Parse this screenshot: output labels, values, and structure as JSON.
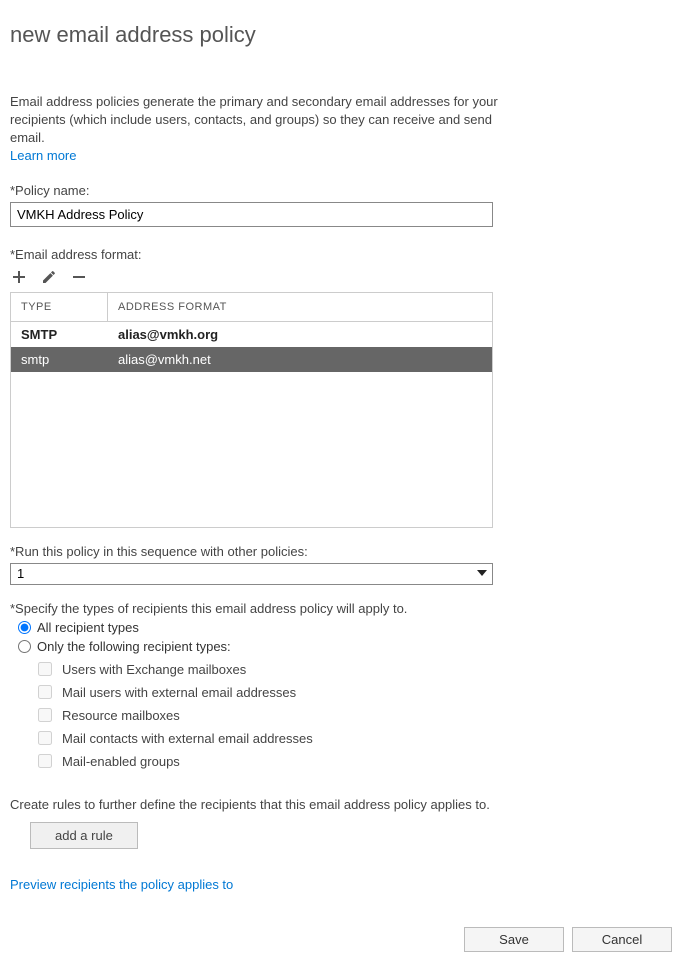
{
  "page": {
    "title": "new email address policy",
    "description": "Email address policies generate the primary and secondary email addresses for your recipients (which include users, contacts, and groups) so they can receive and send email.",
    "learn_more": "Learn more"
  },
  "policy_name": {
    "label": "*Policy name:",
    "value": "VMKH Address Policy"
  },
  "email_format": {
    "label": "*Email address format:",
    "headers": {
      "type": "TYPE",
      "format": "ADDRESS FORMAT"
    },
    "rows": [
      {
        "type": "SMTP",
        "format": "alias@vmkh.org",
        "primary": true,
        "selected": false
      },
      {
        "type": "smtp",
        "format": "alias@vmkh.net",
        "primary": false,
        "selected": true
      }
    ]
  },
  "sequence": {
    "label": "*Run this policy in this sequence with other policies:",
    "value": "1"
  },
  "recipients": {
    "label": "*Specify the types of recipients this email address policy will apply to.",
    "all_label": "All recipient types",
    "only_label": "Only the following recipient types:",
    "types": [
      "Users with Exchange mailboxes",
      "Mail users with external email addresses",
      "Resource mailboxes",
      "Mail contacts with external email addresses",
      "Mail-enabled groups"
    ]
  },
  "rules": {
    "label": "Create rules to further define the recipients that this email address policy applies to.",
    "add_button": "add a rule"
  },
  "preview_link": "Preview recipients the policy applies to",
  "footer": {
    "save": "Save",
    "cancel": "Cancel"
  }
}
